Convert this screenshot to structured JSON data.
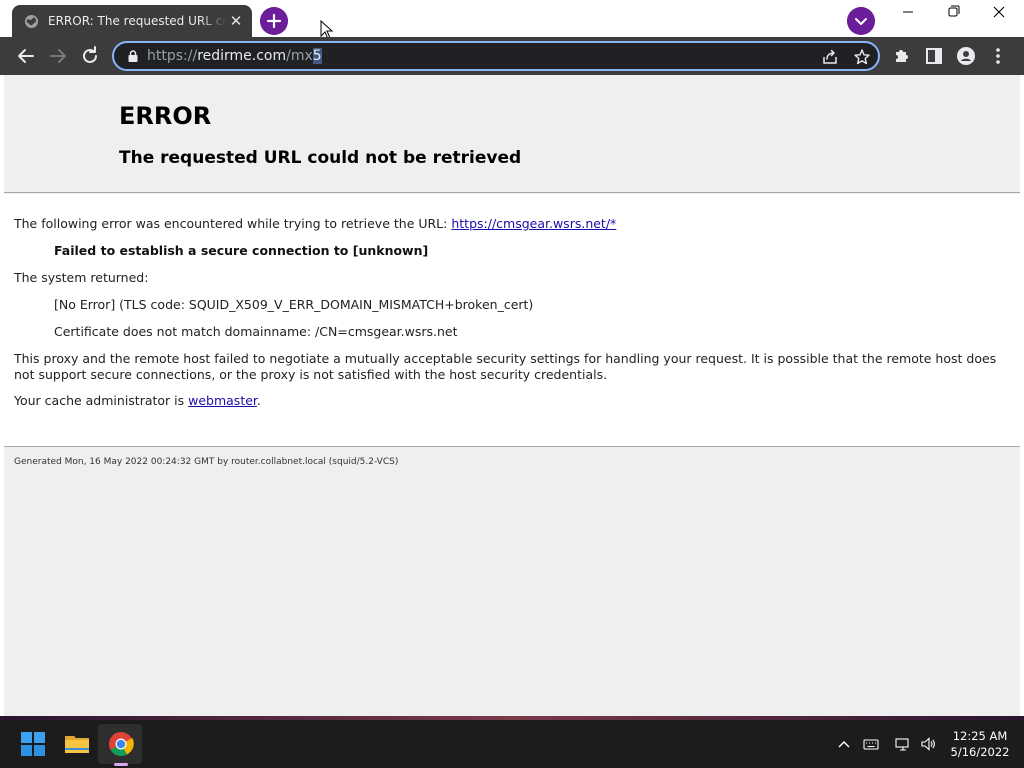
{
  "browser": {
    "tab": {
      "title": "ERROR: The requested URL could not be retrieved",
      "close_glyph": "✕"
    },
    "address_bar": {
      "url_scheme": "https://",
      "url_host": "redirme.com",
      "url_path": "/mx",
      "url_selected": "5"
    }
  },
  "page": {
    "h1": "ERROR",
    "h2": "The requested URL could not be retrieved",
    "intro_text": "The following error was encountered while trying to retrieve the URL: ",
    "intro_link": "https://cmsgear.wsrs.net/*",
    "failure_text": "Failed to establish a secure connection to [unknown]",
    "system_returned_label": "The system returned:",
    "system_error": "[No Error] (TLS code: SQUID_X509_V_ERR_DOMAIN_MISMATCH+broken_cert)",
    "cert_detail": "Certificate does not match domainname: /CN=cmsgear.wsrs.net",
    "explanation": "This proxy and the remote host failed to negotiate a mutually acceptable security settings for handling your request. It is possible that the remote host does not support secure connections, or the proxy is not satisfied with the host security credentials.",
    "admin_prefix": "Your cache administrator is ",
    "admin_link": "webmaster",
    "admin_suffix": ".",
    "footer": "Generated Mon, 16 May 2022 00:24:32 GMT by router.collabnet.local (squid/5.2-VCS)"
  },
  "taskbar": {
    "clock_time": "12:25 AM",
    "clock_date": "5/16/2022"
  },
  "colors": {
    "toolbar_bg": "#3c3c3c",
    "accent_purple": "#6c1d99",
    "omnibox_focus": "#8ab4f8",
    "link": "#1a0dab",
    "taskbar_bg": "#1c1c1c"
  },
  "icons": [
    "globe-icon",
    "close-icon",
    "plus-icon",
    "chevron-down-icon",
    "minimize-icon",
    "maximize-icon",
    "close-window-icon",
    "back-arrow-icon",
    "forward-arrow-icon",
    "reload-icon",
    "lock-icon",
    "share-icon",
    "star-icon",
    "puzzle-icon",
    "side-panel-icon",
    "profile-icon",
    "kebab-menu-icon",
    "windows-start-icon",
    "file-explorer-icon",
    "chrome-icon",
    "chevron-up-icon",
    "keyboard-icon",
    "network-icon",
    "volume-icon"
  ]
}
